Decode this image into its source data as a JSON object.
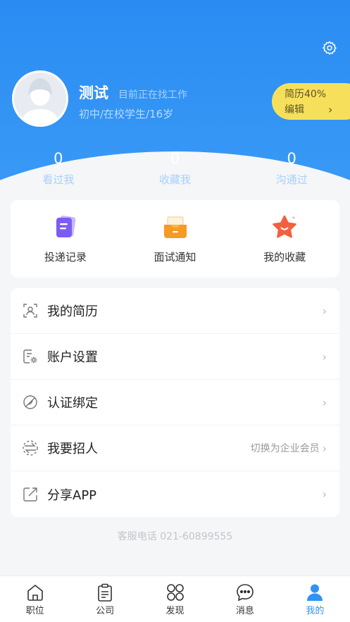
{
  "profile": {
    "name": "测试",
    "job_status": "目前正在找工作",
    "info": "初中/在校学生/16岁",
    "resume_percent_label": "简历40%",
    "edit_label": "编辑",
    "chevron": "›"
  },
  "stats": [
    {
      "value": "0",
      "label": "看过我"
    },
    {
      "value": "0",
      "label": "收藏我"
    },
    {
      "value": "0",
      "label": "沟通过"
    }
  ],
  "quick_actions": [
    {
      "label": "投递记录",
      "icon": "document-icon"
    },
    {
      "label": "面试通知",
      "icon": "inbox-icon"
    },
    {
      "label": "我的收藏",
      "icon": "star-icon"
    }
  ],
  "menu": [
    {
      "label": "我的简历",
      "hint": "",
      "icon": "resume-icon"
    },
    {
      "label": "账户设置",
      "hint": "",
      "icon": "account-settings-icon"
    },
    {
      "label": "认证绑定",
      "hint": "",
      "icon": "verify-icon"
    },
    {
      "label": "我要招人",
      "hint": "切换为企业会员",
      "icon": "switch-icon"
    },
    {
      "label": "分享APP",
      "hint": "",
      "icon": "share-icon"
    }
  ],
  "chevron": "›",
  "service_phone": "客服电话 021-60899555",
  "tabs": [
    {
      "label": "职位",
      "icon": "home-icon"
    },
    {
      "label": "公司",
      "icon": "clipboard-icon"
    },
    {
      "label": "发现",
      "icon": "discover-icon"
    },
    {
      "label": "消息",
      "icon": "message-icon"
    },
    {
      "label": "我的",
      "icon": "user-icon"
    }
  ],
  "active_tab": "我的",
  "colors": {
    "primary": "#2f93f3",
    "pill": "#f6e05b",
    "background": "#f5f6f8"
  }
}
